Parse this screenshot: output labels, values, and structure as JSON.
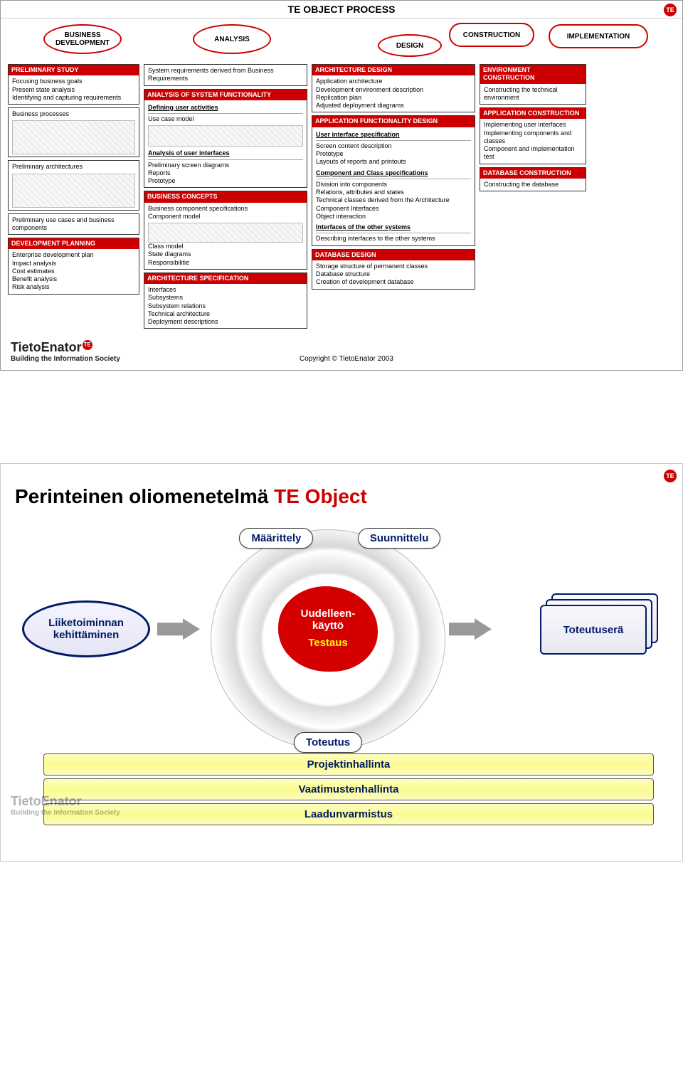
{
  "slide1": {
    "title": "TE OBJECT PROCESS",
    "phases": {
      "p1": "BUSINESS DEVELOPMENT",
      "p2": "ANALYSIS",
      "p3": "DESIGN",
      "p4": "CONSTRUCTION",
      "p5": "IMPLEMENTATION"
    },
    "col1": {
      "preliminary_hdr": "PRELIMINARY STUDY",
      "preliminary_lines": [
        "Focusing business goals",
        "Present state analysis",
        "Identifying and capturing requirements"
      ],
      "bp_label": "Business processes",
      "pa_label": "Preliminary architectures",
      "puc": "Preliminary use cases and business components",
      "devplan_hdr": "DEVELOPMENT PLANNING",
      "devplan_lines": [
        "Enterprise development plan",
        "Impact analysis",
        "Cost estimates",
        "Benefit analysis",
        "Risk analysis"
      ]
    },
    "col2": {
      "sysreq": "System requirements derived from Business Requirements",
      "analysis_hdr": "ANALYSIS OF SYSTEM FUNCTIONALITY",
      "defining": "Defining user activities",
      "usecase": "Use case model",
      "aui": "Analysis of user interfaces",
      "aui_lines": [
        "Preliminary screen diagrams",
        "Reports",
        "Prototype"
      ],
      "bizc_hdr": "BUSINESS CONCEPTS",
      "bizc_lines": [
        "Business component specifications",
        "Component model"
      ],
      "class_lines": [
        "Class model",
        "State diagrams",
        "Responsibilitie"
      ],
      "archspec_hdr": "ARCHITECTURE SPECIFICATION",
      "archspec_lines": [
        "Interfaces",
        "Subsystems",
        "Subsystem relations",
        "Technical architecture",
        "Deployment descriptions"
      ]
    },
    "col3": {
      "archdesign_hdr": "ARCHITECTURE DESIGN",
      "archdesign_lines": [
        "Application architecture",
        "Development environment description",
        "Replication plan",
        "Adjusted deployment diagrams"
      ],
      "appfunc_hdr": "APPLICATION FUNCTIONALITY DESIGN",
      "uispec": "User interface specification",
      "ui_lines": [
        "Screen content description",
        "Prototype",
        "Layouts of reports and printouts"
      ],
      "compclass": "Component and Class specifications",
      "cc_lines": [
        "Division into components",
        "Relations, attributes and states",
        "Technical classes derived from the Architecture"
      ],
      "cc_more": [
        "Component Interfaces",
        "",
        "Object interaction"
      ],
      "ifother": "Interfaces of the other systems",
      "ifother_lines": [
        "Describing interfaces to the other systems"
      ],
      "dbdesign_hdr": "DATABASE DESIGN",
      "db_lines": [
        "Storage structure of permanent classes",
        "Database structure",
        "Creation of development database"
      ]
    },
    "col4": {
      "envc_hdr": "ENVIRONMENT CONSTRUCTION",
      "envc_line": "Constructing the technical environment",
      "appc_hdr": "APPLICATION CONSTRUCTION",
      "appc_lines": [
        "Implementing user interfaces",
        "Implementing components and classes",
        "Component and implementation test"
      ],
      "dbc_hdr": "DATABASE CONSTRUCTION",
      "dbc_line": "Constructing the database"
    },
    "brand_main": "TietoEnator",
    "brand_te": "TE",
    "brand_sub": "Building the Information Society",
    "copyright": "Copyright © TietoEnator 2003"
  },
  "slide2": {
    "title_a": "Perinteinen oliomenetelmä ",
    "title_b": "TE Object",
    "input": "Liiketoiminnan kehittäminen",
    "reuse": "Uudelleen-\nkäyttö",
    "test": "Testaus",
    "maar": "Määrittely",
    "suun": "Suunnittelu",
    "tote": "Toteutus",
    "output": "Toteutuserä",
    "bars": [
      "Projektinhallinta",
      "Vaatimustenhallinta",
      "Laadunvarmistus"
    ],
    "brand_main": "TietoEnator",
    "brand_sub": "Building the Information Society"
  }
}
